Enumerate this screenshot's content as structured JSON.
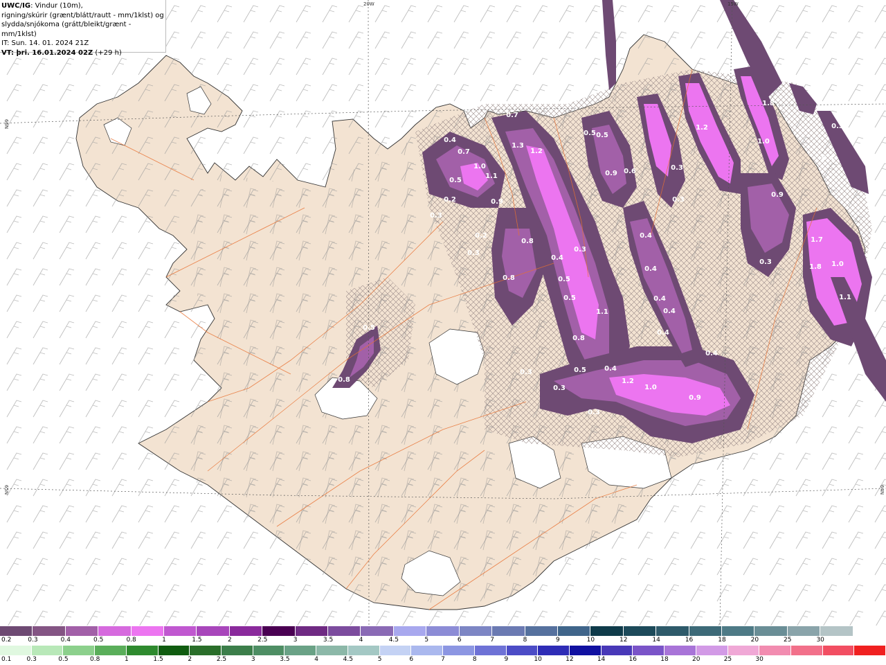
{
  "title": {
    "model": "UWC/IG",
    "desc_line1": ": Vindur (10m),",
    "desc_line2": "rigning/skúrir (grænt/blátt/rautt - mm/1klst) og",
    "desc_line3": "slydda/snjókoma (grátt/bleikt/grænt - mm/1klst)",
    "init_time": "IT: Sun. 14. 01. 2024 21Z",
    "valid_prefix": "VT: þri. 16.01.2024 02Z",
    "valid_suffix": " (+29 h)"
  },
  "grid_labels": {
    "lon_20w": "20W",
    "lon_15w": "15W",
    "lat_66n_left": "66N",
    "lat_65n_left": "65N",
    "lat_64n_right": "64N"
  },
  "precip_values": [
    "0.4",
    "0.7",
    "1.0",
    "1.1",
    "0.5",
    "0.3",
    "0.9",
    "1.3",
    "1.2",
    "0.5",
    "0.6",
    "0.9",
    "0.8",
    "0.4",
    "0.3",
    "0.2",
    "0.8",
    "0.5",
    "0.7",
    "1.2",
    "1.8",
    "1.0",
    "0.3",
    "0.4",
    "0.9",
    "1.7",
    "1.8",
    "1.0",
    "1.1",
    "0.5",
    "0.4",
    "0.3",
    "0.5",
    "1.1",
    "0.8",
    "0.4",
    "0.5",
    "1.2",
    "1.0",
    "0.9",
    "0.3",
    "0.4",
    "0.2",
    "0.3",
    "0.4",
    "0.3",
    "0.5",
    "0.8",
    "0.2",
    "0.3",
    "0.4",
    "0.4",
    "0.4",
    "0.3",
    "0.3"
  ],
  "legend_snow": {
    "colors": [
      "#6e4a73",
      "#845584",
      "#a260a8",
      "#d66ade",
      "#ec75f0",
      "#c058d0",
      "#a846bb",
      "#8a2a9c",
      "#4a0052",
      "#6f2a83",
      "#7c4c9e",
      "#8a6ab5",
      "#a8a8ee",
      "#8c8cd6",
      "#7d86c4",
      "#6b7ab2",
      "#56719e",
      "#40658a",
      "#0f3b4a",
      "#1d4a5a",
      "#2e5a6a",
      "#3d6a78",
      "#4e7a86",
      "#6a8e96",
      "#8aa4aa",
      "#b4c4c6",
      "#ffffff"
    ],
    "labels": [
      "0.2",
      "0.3",
      "0.4",
      "0.5",
      "0.8",
      "1",
      "1.5",
      "2",
      "2.5",
      "3",
      "3.5",
      "4",
      "4.5",
      "5",
      "6",
      "7",
      "8",
      "9",
      "10",
      "12",
      "14",
      "16",
      "18",
      "20",
      "25",
      "30"
    ]
  },
  "legend_rain": {
    "colors": [
      "#e0f8e0",
      "#b8e8b8",
      "#8cd08c",
      "#5aae5a",
      "#2e8a2e",
      "#105c10",
      "#2a6e2a",
      "#3c7e4a",
      "#4e8e64",
      "#6aa286",
      "#8cb8a8",
      "#a4c8c4",
      "#c4d2f4",
      "#aab8ee",
      "#8c96e2",
      "#6e72d6",
      "#4c4cc6",
      "#2e2cb6",
      "#1010a0",
      "#4838b8",
      "#7a54c8",
      "#a874d8",
      "#d29ae6",
      "#f0a8d6",
      "#f28cb0",
      "#f2708a",
      "#f24e62",
      "#f02020"
    ],
    "labels": [
      "0.1",
      "0.3",
      "0.5",
      "0.8",
      "1",
      "1.5",
      "2",
      "2.5",
      "3",
      "3.5",
      "4",
      "4.5",
      "5",
      "6",
      "7",
      "8",
      "9",
      "10",
      "12",
      "14",
      "16",
      "18",
      "20",
      "25",
      "30"
    ]
  },
  "colors": {
    "land": "#f3e3d2",
    "coast": "#333333",
    "roads": "#e87030",
    "snow_cover": "#ffffff",
    "wind_barb": "#9a9a9a"
  }
}
